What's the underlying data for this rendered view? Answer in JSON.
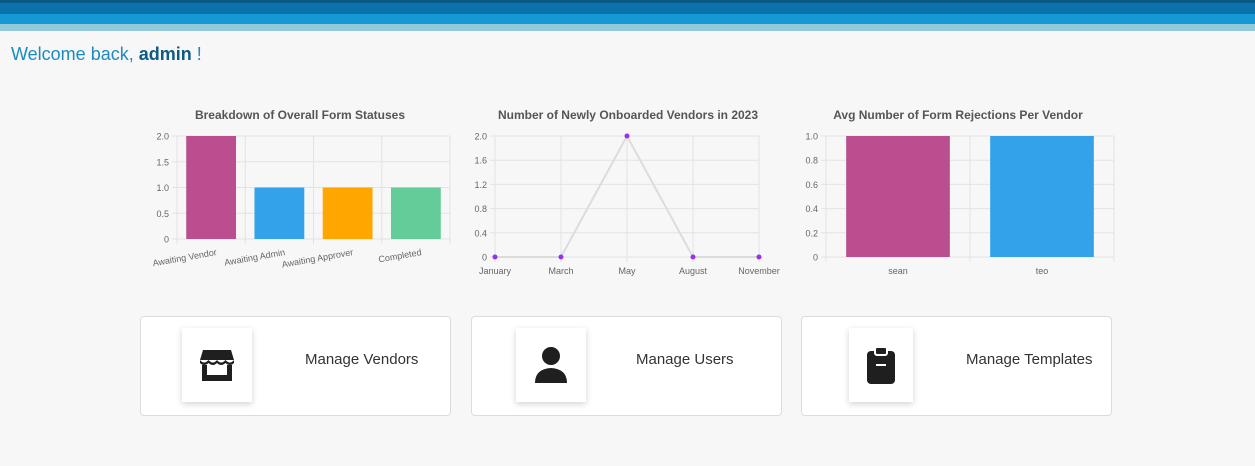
{
  "welcome": {
    "prefix": "Welcome back, ",
    "user": "admin",
    "suffix": " !"
  },
  "chart_data": [
    {
      "type": "bar",
      "title": "Breakdown of Overall Form Statuses",
      "categories": [
        "Awaiting Vendor",
        "Awaiting Admin",
        "Awaiting Approver",
        "Completed"
      ],
      "values": [
        2,
        1,
        1,
        1
      ],
      "colors": [
        "#bb4e8f",
        "#33a2ea",
        "#ffa600",
        "#64cc99"
      ],
      "yticks": [
        "0",
        "0.5",
        "1.0",
        "1.5",
        "2.0"
      ],
      "ylim": [
        0,
        2
      ],
      "grid": true
    },
    {
      "type": "line",
      "title": "Number of Newly Onboarded Vendors in 2023",
      "categories": [
        "January",
        "March",
        "May",
        "August",
        "November"
      ],
      "values": [
        0,
        0,
        2,
        0,
        0
      ],
      "line_color": "#dcdcdc",
      "point_color": "#9b30e8",
      "yticks": [
        "0",
        "0.4",
        "0.8",
        "1.2",
        "1.6",
        "2.0"
      ],
      "ylim": [
        0,
        2
      ],
      "grid": true
    },
    {
      "type": "bar",
      "title": "Avg Number of Form Rejections Per Vendor",
      "categories": [
        "sean",
        "teo"
      ],
      "values": [
        1,
        1
      ],
      "colors": [
        "#bb4e8f",
        "#33a2ea"
      ],
      "yticks": [
        "0",
        "0.2",
        "0.4",
        "0.6",
        "0.8",
        "1.0"
      ],
      "ylim": [
        0,
        1
      ],
      "grid": true
    }
  ],
  "cards": {
    "vendors": {
      "label": "Manage Vendors",
      "icon": "store-icon"
    },
    "users": {
      "label": "Manage Users",
      "icon": "user-icon"
    },
    "templates": {
      "label": "Manage Templates",
      "icon": "clipboard-icon"
    }
  }
}
